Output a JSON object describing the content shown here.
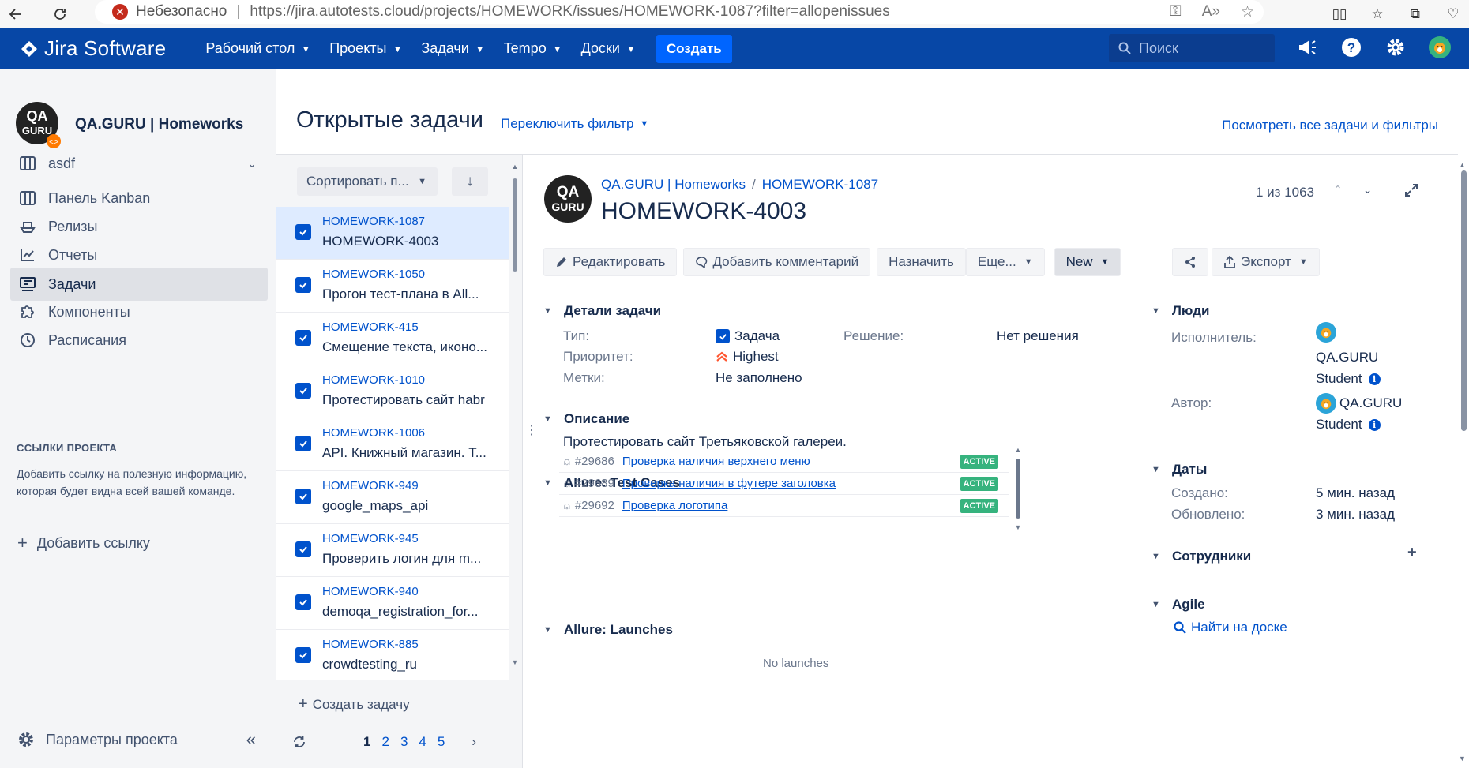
{
  "browser": {
    "security_label": "Небезопасно",
    "url": "https://jira.autotests.cloud/projects/HOMEWORK/issues/HOMEWORK-1087?filter=allopenissues"
  },
  "topnav": {
    "app_name": "Jira Software",
    "menu": [
      {
        "label": "Рабочий стол"
      },
      {
        "label": "Проекты"
      },
      {
        "label": "Задачи"
      },
      {
        "label": "Tempo"
      },
      {
        "label": "Доски"
      }
    ],
    "create_label": "Создать",
    "search_placeholder": "Поиск"
  },
  "sidebar": {
    "project_name": "QA.GURU | Homeworks",
    "board_selector": "asdf",
    "items": [
      {
        "label": "Панель Kanban",
        "icon": "board-icon"
      },
      {
        "label": "Релизы",
        "icon": "ship-icon"
      },
      {
        "label": "Отчеты",
        "icon": "chart-icon"
      },
      {
        "label": "Задачи",
        "icon": "issues-icon"
      },
      {
        "label": "Компоненты",
        "icon": "puzzle-icon"
      },
      {
        "label": "Расписания",
        "icon": "clock-icon"
      }
    ],
    "links_section_title": "ССЫЛКИ ПРОЕКТА",
    "links_description": "Добавить ссылку на полезную информацию, которая будет видна всей вашей команде.",
    "add_link_label": "Добавить ссылку",
    "settings_label": "Параметры проекта"
  },
  "header": {
    "title": "Открытые задачи",
    "switch_filter": "Переключить фильтр",
    "view_all": "Посмотреть все задачи и фильтры"
  },
  "list": {
    "sort_label": "Сортировать п...",
    "issues": [
      {
        "key": "HOMEWORK-1087",
        "summary": "HOMEWORK-4003"
      },
      {
        "key": "HOMEWORK-1050",
        "summary": "Прогон тест-плана в All..."
      },
      {
        "key": "HOMEWORK-415",
        "summary": "Смещение текста, иконо..."
      },
      {
        "key": "HOMEWORK-1010",
        "summary": "Протестировать сайт habr"
      },
      {
        "key": "HOMEWORK-1006",
        "summary": "API. Книжный магазин. T..."
      },
      {
        "key": "HOMEWORK-949",
        "summary": "google_maps_api"
      },
      {
        "key": "HOMEWORK-945",
        "summary": "Проверить логин для m..."
      },
      {
        "key": "HOMEWORK-940",
        "summary": "demoqa_registration_for..."
      },
      {
        "key": "HOMEWORK-885",
        "summary": "crowdtesting_ru"
      }
    ],
    "create_task": "Создать задачу",
    "pages": [
      "1",
      "2",
      "3",
      "4",
      "5"
    ],
    "current_page": "1"
  },
  "issue": {
    "breadcrumb_project": "QA.GURU | Homeworks",
    "breadcrumb_key": "HOMEWORK-1087",
    "title": "HOMEWORK-4003",
    "position": "1 из 1063",
    "toolbar": {
      "edit": "Редактировать",
      "comment": "Добавить комментарий",
      "assign": "Назначить",
      "more": "Еще...",
      "status": "New",
      "export": "Экспорт"
    },
    "details": {
      "section": "Детали задачи",
      "type_label": "Тип:",
      "type_value": "Задача",
      "priority_label": "Приоритет:",
      "priority_value": "Highest",
      "labels_label": "Метки:",
      "labels_value": "Не заполнено",
      "resolution_label": "Решение:",
      "resolution_value": "Нет решения"
    },
    "description": {
      "section": "Описание",
      "text": "Протестировать сайт Третьяковской галереи."
    },
    "allure_cases": {
      "section": "Allure: Test Cases",
      "rows": [
        {
          "id": "#29686",
          "name": "Проверка наличия верхнего меню",
          "status": "ACTIVE"
        },
        {
          "id": "#29689",
          "name": "Проверка наличия в футере заголовка",
          "status": "ACTIVE"
        },
        {
          "id": "#29692",
          "name": "Проверка логотипа",
          "status": "ACTIVE"
        }
      ]
    },
    "allure_launches": {
      "section": "Allure: Launches",
      "empty": "No launches"
    },
    "people": {
      "section": "Люди",
      "assignee_label": "Исполнитель:",
      "assignee_line1": "QA.GURU",
      "assignee_line2": "Student",
      "author_label": "Автор:",
      "author_line1": "QA.GURU",
      "author_line2": "Student"
    },
    "dates": {
      "section": "Даты",
      "created_label": "Создано:",
      "created_value": "5 мин. назад",
      "updated_label": "Обновлено:",
      "updated_value": "3 мин. назад"
    },
    "staff": {
      "section": "Сотрудники"
    },
    "agile": {
      "section": "Agile",
      "link": "Найти на доске"
    }
  },
  "colors": {
    "nav_bg": "#0747a6",
    "accent": "#0052cc",
    "create_btn": "#0065ff",
    "badge_active": "#36b37e",
    "priority_highest": "#ff5630"
  }
}
